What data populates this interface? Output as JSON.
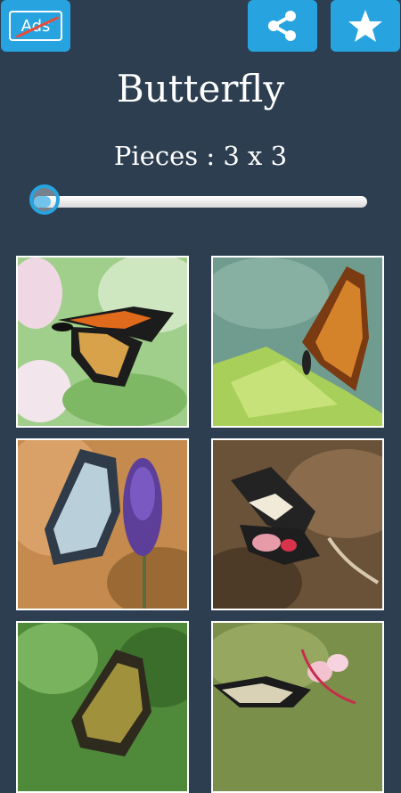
{
  "header": {
    "ads_label": "Ads",
    "share_icon": "share-icon",
    "star_icon": "star-icon",
    "accent_color": "#27a4e0"
  },
  "title": "Butterfly",
  "pieces": {
    "label": "Pieces : 3 x 3",
    "slider_fraction": 0.05
  },
  "gallery": {
    "tiles": [
      {
        "subject": "monarch-butterfly"
      },
      {
        "subject": "orange-butterfly-on-leaf"
      },
      {
        "subject": "butterfly-on-lavender"
      },
      {
        "subject": "black-red-butterfly"
      },
      {
        "subject": "striped-butterfly"
      },
      {
        "subject": "butterfly-on-flower"
      }
    ]
  }
}
